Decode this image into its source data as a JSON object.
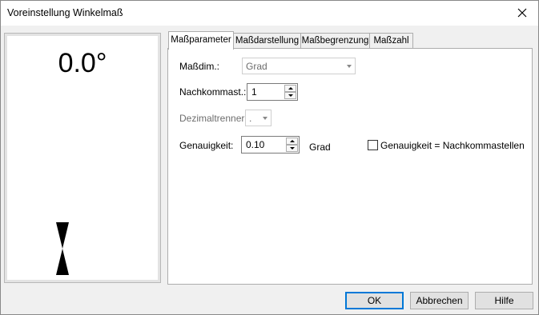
{
  "window": {
    "title": "Voreinstellung Winkelmaß"
  },
  "preview": {
    "angle_text": "0.0°"
  },
  "tabs": [
    {
      "label": "Maßparameter",
      "active": true
    },
    {
      "label": "Maßdarstellung",
      "active": false
    },
    {
      "label": "Maßbegrenzung",
      "active": false
    },
    {
      "label": "Maßzahl",
      "active": false
    }
  ],
  "params": {
    "dimension": {
      "label": "Maßdim.:",
      "value": "Grad",
      "enabled": false
    },
    "decimals": {
      "label": "Nachkommast.:",
      "value": "1"
    },
    "decimal_separator": {
      "label": "Dezimaltrenner:",
      "value": ".",
      "enabled": false
    },
    "precision": {
      "label": "Genauigkeit:",
      "value": "0.10",
      "unit": "Grad"
    },
    "precision_checkbox": {
      "label": "Genauigkeit = Nachkommastellen",
      "checked": false
    }
  },
  "buttons": {
    "ok": "OK",
    "cancel": "Abbrechen",
    "help": "Hilfe"
  },
  "icons": {
    "close": "close-icon",
    "marker": "hourglass-marker-icon"
  }
}
